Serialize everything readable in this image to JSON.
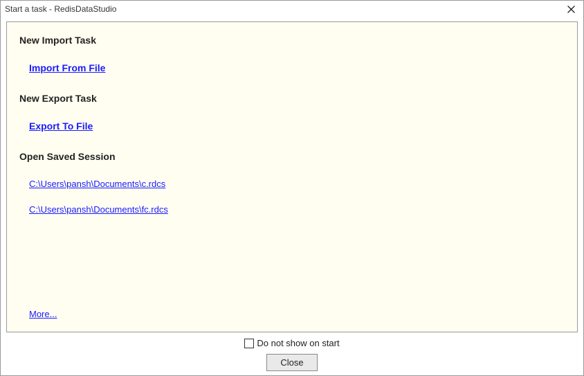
{
  "window": {
    "title": "Start a task - RedisDataStudio"
  },
  "sections": {
    "import": {
      "heading": "New Import Task",
      "action": "Import From File"
    },
    "export": {
      "heading": "New Export Task",
      "action": "Export To File"
    },
    "sessions": {
      "heading": "Open Saved Session",
      "items": [
        "C:\\Users\\pansh\\Documents\\c.rdcs",
        "C:\\Users\\pansh\\Documents\\fc.rdcs"
      ]
    },
    "more": "More..."
  },
  "footer": {
    "checkbox_label": "Do not show on start",
    "close_label": "Close"
  }
}
